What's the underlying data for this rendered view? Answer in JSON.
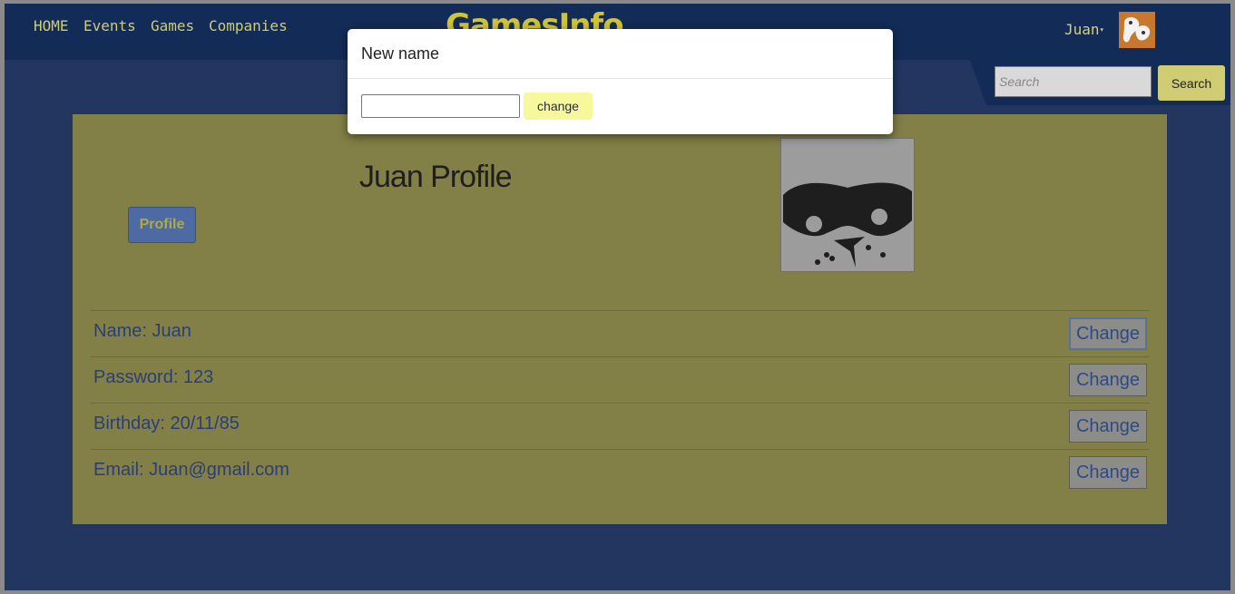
{
  "nav": {
    "links": [
      "HOME",
      "Events",
      "Games",
      "Companies"
    ],
    "logo": "GamesInfo",
    "user_name": "Juan",
    "caret": "▾"
  },
  "search": {
    "placeholder": "Search",
    "button_label": "Search"
  },
  "profile": {
    "tab_label": "Profile",
    "title": "Juan Profile",
    "rows": [
      {
        "label": "Name: Juan",
        "button": "Change"
      },
      {
        "label": "Password: 123",
        "button": "Change"
      },
      {
        "label": "Birthday: 20/11/85",
        "button": "Change"
      },
      {
        "label": "Email: Juan@gmail.com",
        "button": "Change"
      }
    ]
  },
  "modal": {
    "title": "New name",
    "input_value": "",
    "button_label": "change"
  },
  "colors": {
    "nav_bg": "#132b57",
    "page_bg": "#22365f",
    "panel_bg": "#827f47",
    "accent_yellow": "#cfcc74",
    "link_blue": "#2a3f78"
  },
  "icons": {
    "user_avatar": "cartoon-avatar-icon",
    "profile_avatar": "masked-face-icon"
  }
}
